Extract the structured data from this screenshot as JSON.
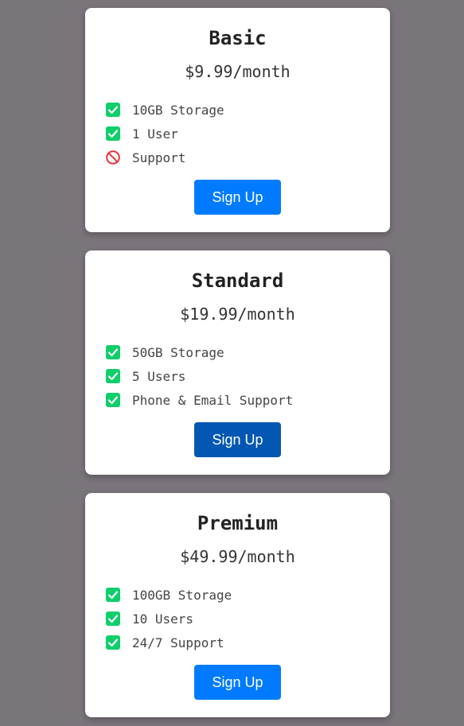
{
  "plans": [
    {
      "title": "Basic",
      "price": "$9.99/month",
      "features": [
        {
          "text": "10GB Storage",
          "icon": "check-icon"
        },
        {
          "text": "1 User",
          "icon": "check-icon"
        },
        {
          "text": "Support",
          "icon": "prohibited-icon"
        }
      ],
      "button_label": "Sign Up"
    },
    {
      "title": "Standard",
      "price": "$19.99/month",
      "features": [
        {
          "text": "50GB Storage",
          "icon": "check-icon"
        },
        {
          "text": "5 Users",
          "icon": "check-icon"
        },
        {
          "text": "Phone & Email Support",
          "icon": "check-icon"
        }
      ],
      "button_label": "Sign Up"
    },
    {
      "title": "Premium",
      "price": "$49.99/month",
      "features": [
        {
          "text": "100GB Storage",
          "icon": "check-icon"
        },
        {
          "text": "10 Users",
          "icon": "check-icon"
        },
        {
          "text": "24/7 Support",
          "icon": "check-icon"
        }
      ],
      "button_label": "Sign Up"
    }
  ],
  "colors": {
    "background": "#7a747b",
    "card": "#ffffff",
    "check": "#0ecf6a",
    "prohibited": "#e5343a",
    "button": "#007bff",
    "button_hover": "#0257b2"
  }
}
